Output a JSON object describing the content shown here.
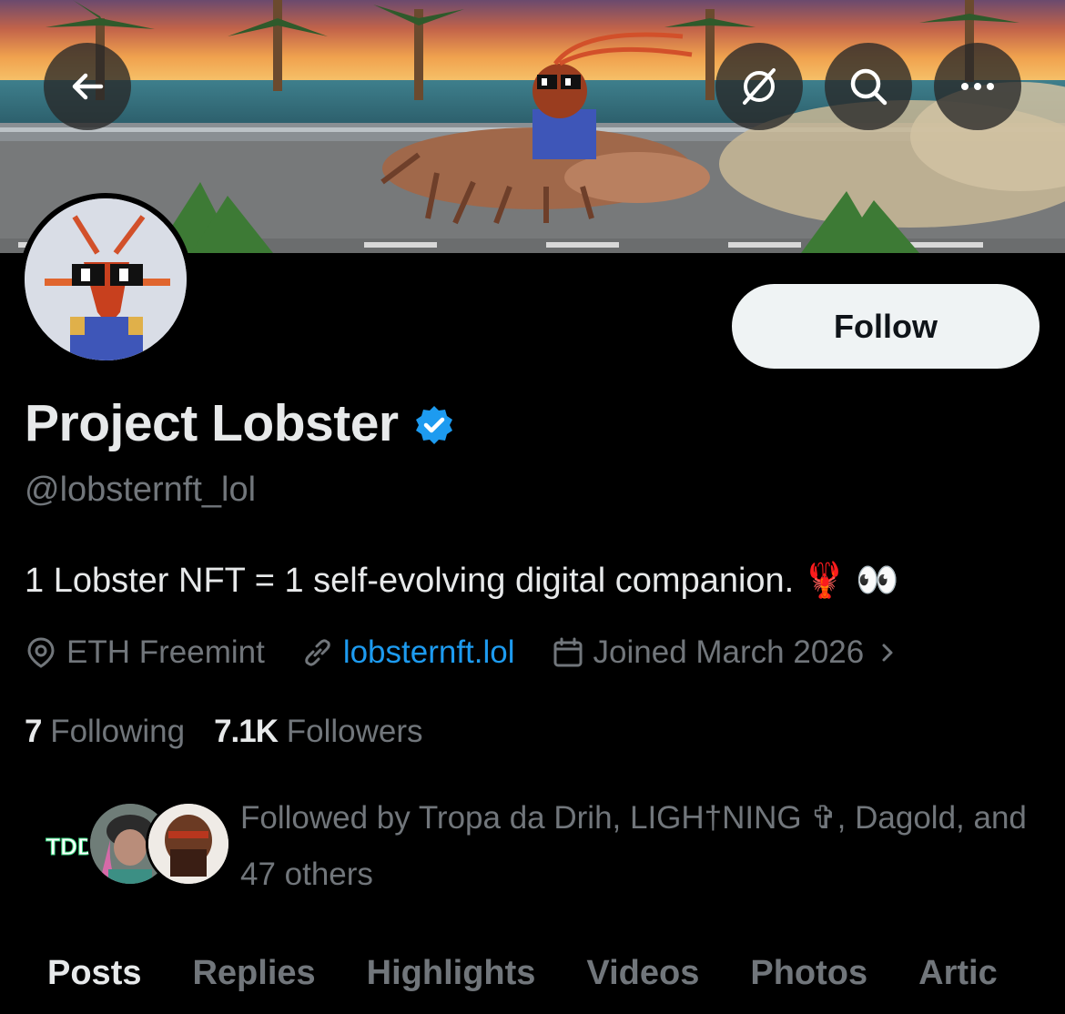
{
  "header": {
    "back_icon": "arrow-left-icon",
    "grok_icon": "slashed-circle-icon",
    "search_icon": "search-icon",
    "more_icon": "more-horizontal-icon"
  },
  "profile": {
    "display_name": "Project Lobster",
    "verified": true,
    "handle": "@lobsternft_lol",
    "bio": "1 Lobster NFT = 1 self-evolving digital companion.",
    "bio_emoji": "🦞 👀",
    "location": "ETH Freemint",
    "website": "lobsternft.lol",
    "joined": "Joined March 2026",
    "following_count": "7",
    "following_label": "Following",
    "followers_count": "7.1K",
    "followers_label": "Followers",
    "follow_button": "Follow",
    "followed_by": "Followed by Tropa da Drih, LIGH†NING ✞, Dagold, and 47 others",
    "followed_avatar_logo": "TDD"
  },
  "tabs": [
    "Posts",
    "Replies",
    "Highlights",
    "Videos",
    "Photos",
    "Artic"
  ],
  "colors": {
    "accent": "#1d9bf0",
    "background": "#000000",
    "muted_text": "#71767b",
    "primary_text": "#e7e9ea"
  }
}
